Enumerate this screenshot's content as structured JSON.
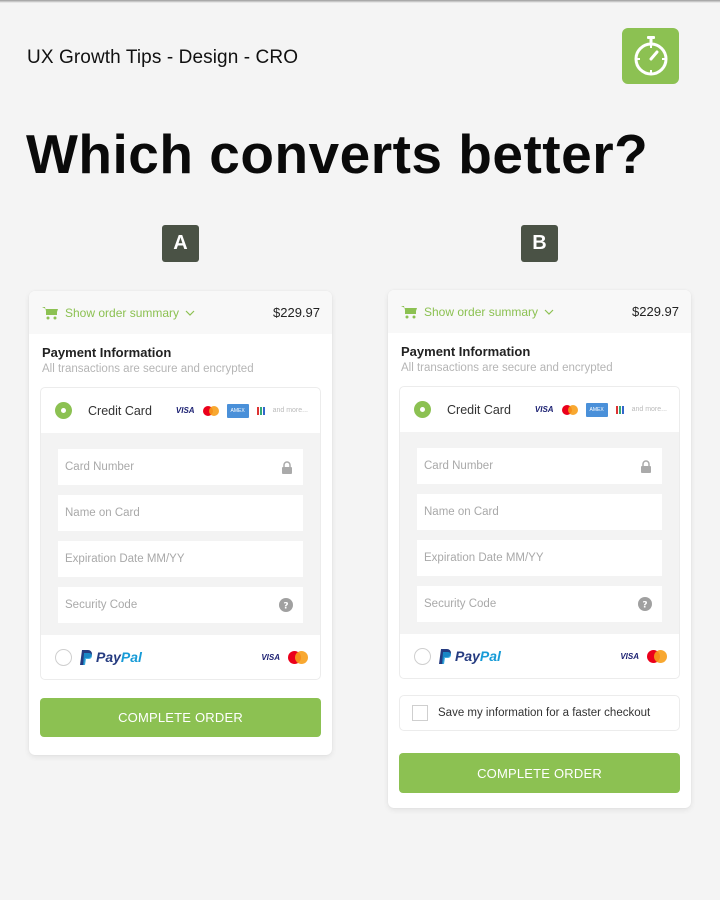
{
  "header": {
    "brand_line": "UX Growth Tips - Design - CRO",
    "logo_icon": "stopwatch-icon",
    "headline": "Which converts better?"
  },
  "colors": {
    "accent": "#8cc152",
    "badge": "#4a5245",
    "background": "#f4f4f4"
  },
  "variants": [
    {
      "badge": "A",
      "summary": {
        "link_label": "Show order summary",
        "total": "$229.97"
      },
      "payment_title": "Payment Information",
      "payment_subtitle": "All transactions are secure and encrypted",
      "credit_card": {
        "label": "Credit Card",
        "selected": true,
        "brands": [
          "VISA",
          "Mastercard",
          "AMEX",
          "Discover"
        ],
        "visa_label": "VISA",
        "amex_label": "AMEX",
        "more_label": "and more..."
      },
      "fields": [
        {
          "placeholder": "Card Number",
          "icon": "lock-icon"
        },
        {
          "placeholder": "Name on Card",
          "icon": ""
        },
        {
          "placeholder": "Expiration Date MM/YY",
          "icon": ""
        },
        {
          "placeholder": "Security Code",
          "icon": "help-icon"
        }
      ],
      "paypal": {
        "label_pay": "Pay",
        "label_pal": "Pal",
        "selected": false,
        "visa_label": "VISA"
      },
      "cta_label": "COMPLETE ORDER"
    },
    {
      "badge": "B",
      "summary": {
        "link_label": "Show order summary",
        "total": "$229.97"
      },
      "payment_title": "Payment Information",
      "payment_subtitle": "All transactions are secure and encrypted",
      "credit_card": {
        "label": "Credit Card",
        "selected": true,
        "brands": [
          "VISA",
          "Mastercard",
          "AMEX",
          "Discover"
        ],
        "visa_label": "VISA",
        "amex_label": "AMEX",
        "more_label": "and more..."
      },
      "fields": [
        {
          "placeholder": "Card Number",
          "icon": "lock-icon"
        },
        {
          "placeholder": "Name on Card",
          "icon": ""
        },
        {
          "placeholder": "Expiration Date MM/YY",
          "icon": ""
        },
        {
          "placeholder": "Security Code",
          "icon": "help-icon"
        }
      ],
      "paypal": {
        "label_pay": "Pay",
        "label_pal": "Pal",
        "selected": false,
        "visa_label": "VISA"
      },
      "save_info": {
        "label": "Save my information for a faster checkout",
        "checked": false
      },
      "cta_label": "COMPLETE ORDER"
    }
  ]
}
